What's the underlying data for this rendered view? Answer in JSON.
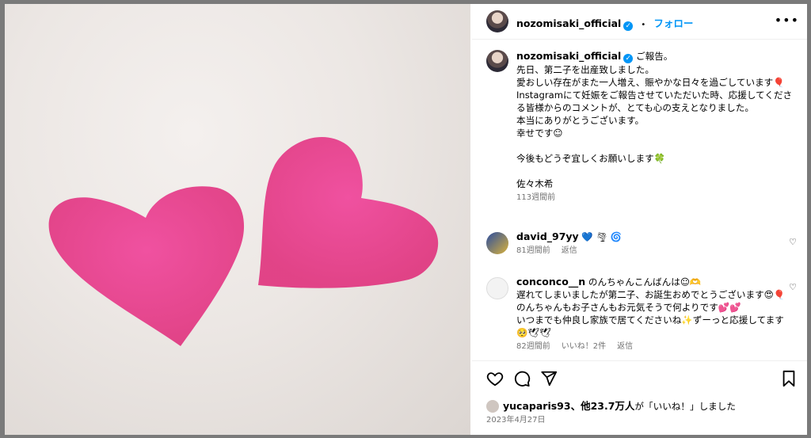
{
  "header": {
    "username": "nozomisaki_official",
    "dot": "•",
    "follow": "フォロー",
    "more": "•••"
  },
  "caption": {
    "username": "nozomisaki_official",
    "text": " ご報告。\n先日、第二子を出産致しました。\n愛おしい存在がまた一人増え、賑やかな日々を過ごしています🎈\nInstagramにて妊娠をご報告させていただいた時、応援してくださる皆様からのコメントが、とても心の支えとなりました。\n本当にありがとうございます。\n幸せです☺\n\n今後もどうぞ宜しくお願いします🍀\n\n佐々木希",
    "time": "113週間前"
  },
  "comments": [
    {
      "username": "david_97yy",
      "text": " 💙 🌪 🌀",
      "time": "81週間前",
      "reply": "返信"
    },
    {
      "username": "conconco__n",
      "text": " のんちゃんこんばんは☺🫶\n遅れてしまいましたが第二子、お誕生おめでとうございます😍🎈のんちゃんもお子さんもお元気そうで何よりです💕💕\nいつまでも仲良し家族で居てくださいね✨ずーっと応援してます🥺🕊🕊",
      "time": "82週間前",
      "likes": "いいね！2件",
      "reply": "返信"
    }
  ],
  "likes": {
    "user": "yucaparis93",
    "rest": "、他23.7万人",
    "suffix": "が「いいね！」しました"
  },
  "date": "2023年4月27日",
  "icons": [
    "heart-icon",
    "comment-icon",
    "share-icon",
    "bookmark-icon"
  ],
  "colors": {
    "accent": "#0095f6",
    "heart": "#e83e8c"
  }
}
